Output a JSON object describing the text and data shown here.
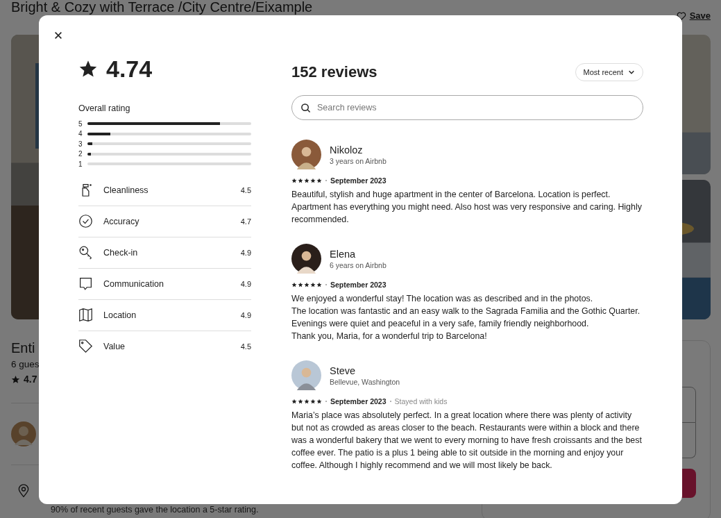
{
  "page": {
    "title": "Bright & Cozy with Terrace /City Centre/Eixample",
    "save": "Save",
    "listing_heading": "Enti",
    "guests": "6 gues",
    "rating": "4.7",
    "location_note": "90% of recent guests gave the location a 5-star rating."
  },
  "modal": {
    "rating": "4.74",
    "overall_label": "Overall rating",
    "distribution": [
      {
        "label": "5",
        "level": 0.81
      },
      {
        "label": "4",
        "level": 0.14
      },
      {
        "label": "3",
        "level": 0.03
      },
      {
        "label": "2",
        "level": 0.02
      },
      {
        "label": "1",
        "level": 0
      }
    ],
    "categories": [
      {
        "kind": "spray",
        "label": "Cleanliness",
        "value": "4.5"
      },
      {
        "kind": "check",
        "label": "Accuracy",
        "value": "4.7"
      },
      {
        "kind": "key",
        "label": "Check-in",
        "value": "4.9"
      },
      {
        "kind": "chat",
        "label": "Communication",
        "value": "4.9"
      },
      {
        "kind": "map",
        "label": "Location",
        "value": "4.9"
      },
      {
        "kind": "tag",
        "label": "Value",
        "value": "4.5"
      }
    ],
    "reviews_title": "152 reviews",
    "sort": "Most recent",
    "search": {
      "placeholder": "Search reviews"
    },
    "reviews": [
      {
        "name": "Nikoloz",
        "subtitle": "3 years on Airbnb",
        "stars": 5,
        "date": "September 2023",
        "text": "Beautiful, stylish and huge apartment in the center of Barcelona. Location is perfect. Apartment has everything you might need. Also host was very responsive and caring. Highly recommended."
      },
      {
        "name": "Elena",
        "subtitle": "6 years on Airbnb",
        "stars": 5,
        "date": "September 2023",
        "text": "We enjoyed a wonderful stay! The location was as described and in the photos.\nThe location was fantastic and an easy walk to the Sagrada Familia and the Gothic Quarter.\nEvenings were quiet and peaceful in a very safe, family friendly neighborhood.\nThank you, Maria, for a wonderful trip to Barcelona!"
      },
      {
        "name": "Steve",
        "subtitle": "Bellevue, Washington",
        "stars": 5,
        "date": "September 2023",
        "tag": "Stayed with kids",
        "text": "Maria’s place was absolutely perfect. In a great location where there was plenty of activity but not as crowded as areas closer to the beach. Restaurants were within a block and there was a wonderful bakery that we went to every morning to have fresh croissants and the best coffee ever. The patio is a plus 1 being able to sit outside in the morning and enjoy your coffee. Although I highly recommend and we will most likely be back."
      }
    ]
  }
}
